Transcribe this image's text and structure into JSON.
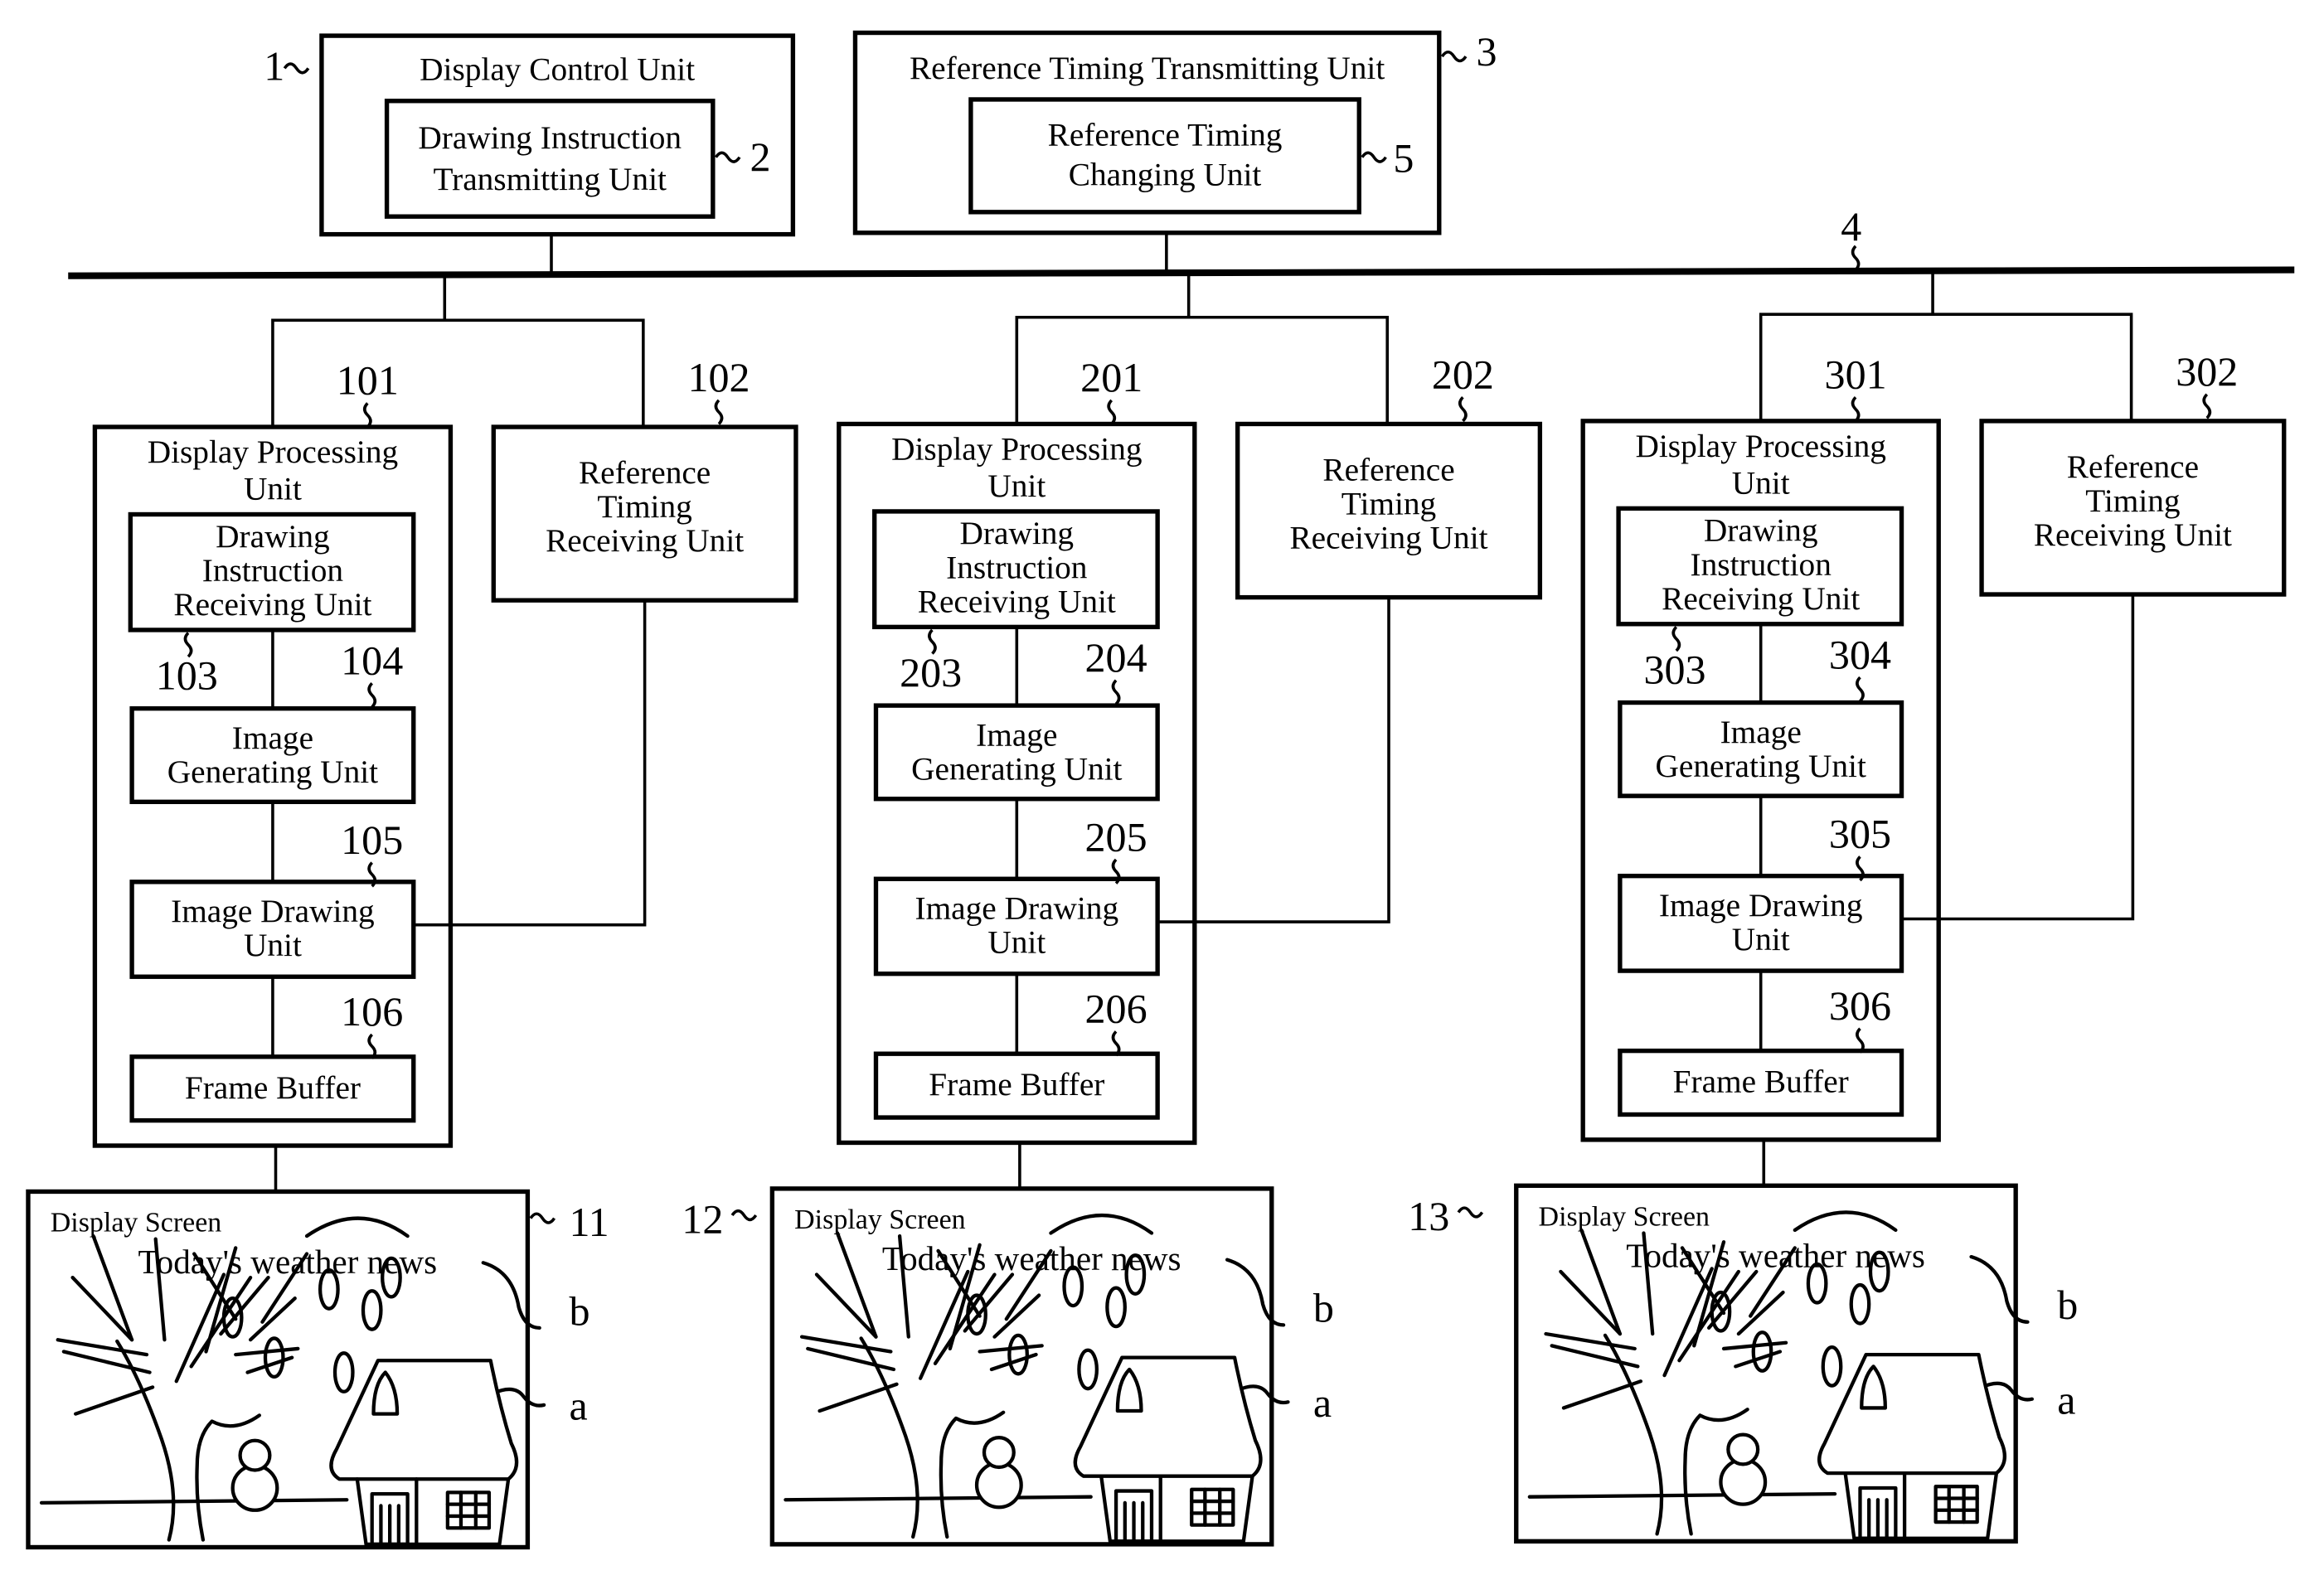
{
  "top": {
    "display_control": {
      "title": "Display Control Unit",
      "ref": "1"
    },
    "drawing_tx": {
      "line1": "Drawing Instruction",
      "line2": "Transmitting Unit",
      "ref": "2"
    },
    "ref_timing_tx": {
      "title": "Reference Timing Transmitting Unit",
      "ref": "3"
    },
    "ref_timing_change": {
      "line1": "Reference Timing",
      "line2": "Changing Unit",
      "ref": "5"
    },
    "bus_ref": "4"
  },
  "columns": [
    {
      "dpu": {
        "line1": "Display Processing",
        "line2": "Unit",
        "ref": "101"
      },
      "rtr": {
        "line1": "Reference",
        "line2": "Timing",
        "line3": "Receiving Unit",
        "ref": "102"
      },
      "dir": {
        "line1": "Drawing",
        "line2": "Instruction",
        "line3": "Receiving Unit",
        "ref": "103"
      },
      "igu": {
        "line1": "Image",
        "line2": "Generating Unit",
        "ref": "104"
      },
      "idu": {
        "line1": "Image Drawing",
        "line2": "Unit",
        "ref": "105"
      },
      "fb": {
        "label": "Frame Buffer",
        "ref": "106"
      },
      "screen": {
        "title": "Display Screen",
        "headline": "Today's weather news",
        "ref": "11",
        "label_b": "b",
        "label_a": "a"
      }
    },
    {
      "dpu": {
        "line1": "Display Processing",
        "line2": "Unit",
        "ref": "201"
      },
      "rtr": {
        "line1": "Reference",
        "line2": "Timing",
        "line3": "Receiving Unit",
        "ref": "202"
      },
      "dir": {
        "line1": "Drawing",
        "line2": "Instruction",
        "line3": "Receiving Unit",
        "ref": "203"
      },
      "igu": {
        "line1": "Image",
        "line2": "Generating Unit",
        "ref": "204"
      },
      "idu": {
        "line1": "Image Drawing",
        "line2": "Unit",
        "ref": "205"
      },
      "fb": {
        "label": "Frame Buffer",
        "ref": "206"
      },
      "screen": {
        "title": "Display Screen",
        "headline": "Today's weather news",
        "ref": "12",
        "label_b": "b",
        "label_a": "a"
      }
    },
    {
      "dpu": {
        "line1": "Display Processing",
        "line2": "Unit",
        "ref": "301"
      },
      "rtr": {
        "line1": "Reference",
        "line2": "Timing",
        "line3": "Receiving Unit",
        "ref": "302"
      },
      "dir": {
        "line1": "Drawing",
        "line2": "Instruction",
        "line3": "Receiving Unit",
        "ref": "303"
      },
      "igu": {
        "line1": "Image",
        "line2": "Generating Unit",
        "ref": "304"
      },
      "idu": {
        "line1": "Image Drawing",
        "line2": "Unit",
        "ref": "305"
      },
      "fb": {
        "label": "Frame Buffer",
        "ref": "306"
      },
      "screen": {
        "title": "Display Screen",
        "headline": "Today's weather news",
        "ref": "13",
        "label_b": "b",
        "label_a": "a"
      }
    }
  ]
}
